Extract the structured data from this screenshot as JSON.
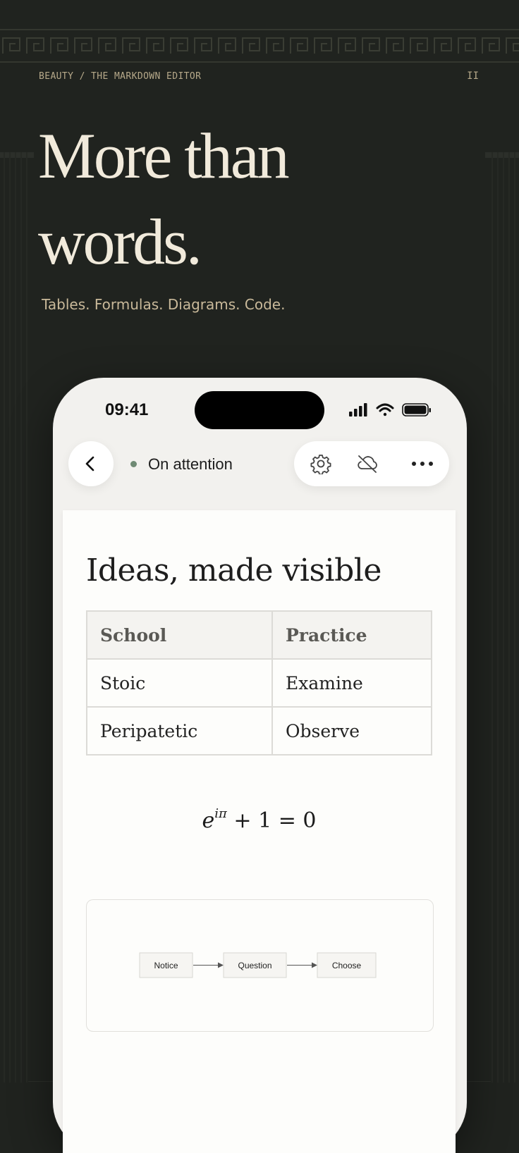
{
  "header": {
    "breadcrumb": "BEAUTY / THE MARKDOWN EDITOR",
    "page_number": "II"
  },
  "hero": {
    "headline_line1": "More than",
    "headline_line2": "words.",
    "subheadline": "Tables. Formulas. Diagrams. Code."
  },
  "phone": {
    "status_bar": {
      "time": "09:41",
      "icons": [
        "cellular-signal-icon",
        "wifi-icon",
        "battery-icon"
      ]
    },
    "nav": {
      "back_icon": "chevron-left-icon",
      "note_title": "On attention",
      "status_dot_color": "#6f8a74",
      "actions": [
        "gear-icon",
        "cloud-off-icon",
        "more-icon"
      ]
    },
    "document": {
      "title": "Ideas, made visible",
      "table": {
        "headers": [
          "School",
          "Practice"
        ],
        "rows": [
          [
            "Stoic",
            "Examine"
          ],
          [
            "Peripatetic",
            "Observe"
          ]
        ]
      },
      "formula": {
        "base": "e",
        "exponent": "iπ",
        "rest": "+ 1 = 0"
      },
      "diagram": {
        "nodes": [
          "Notice",
          "Question",
          "Choose"
        ]
      }
    }
  },
  "colors": {
    "background": "#20231f",
    "headline": "#f1eadb",
    "accent_text": "#c9b99a",
    "phone_body": "#f2f1ee"
  }
}
